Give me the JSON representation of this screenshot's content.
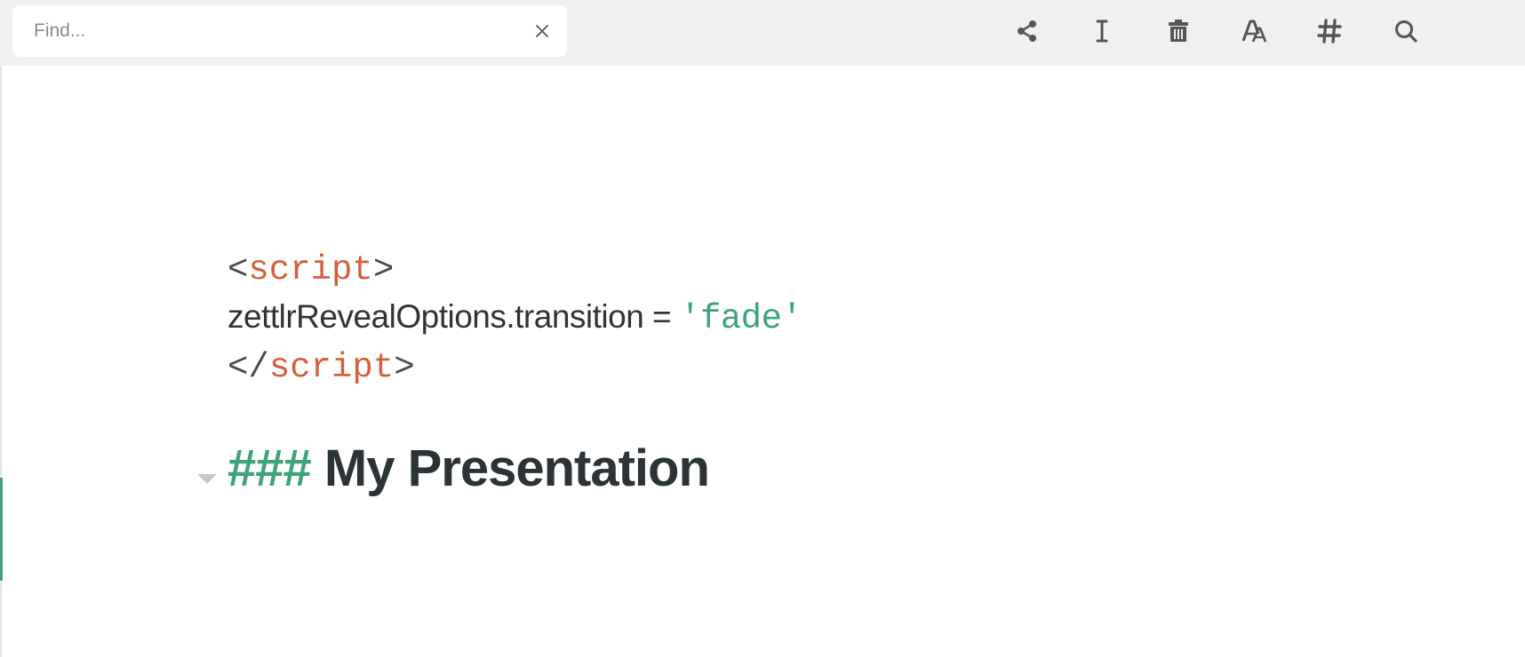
{
  "search": {
    "placeholder": "Find...",
    "clear_icon": "close-icon"
  },
  "toolbar": {
    "icons": [
      "share-icon",
      "text-cursor-icon",
      "trash-icon",
      "font-icon",
      "hashtag-icon",
      "search-icon"
    ]
  },
  "editor": {
    "lines": [
      {
        "open_bracket": "<",
        "tag": "script",
        "close_bracket": ">"
      },
      {
        "text": "zettlrRevealOptions.transition = ",
        "string": "'fade'"
      },
      {
        "open_bracket": "</",
        "tag": "script",
        "close_bracket": ">"
      }
    ],
    "heading": {
      "marker": "###",
      "text": " My Presentation"
    }
  },
  "colors": {
    "tag": "#d65f3a",
    "string": "#3fa37a",
    "heading_marker": "#3fa37a",
    "toolbar_bg": "#f0f0f0"
  }
}
